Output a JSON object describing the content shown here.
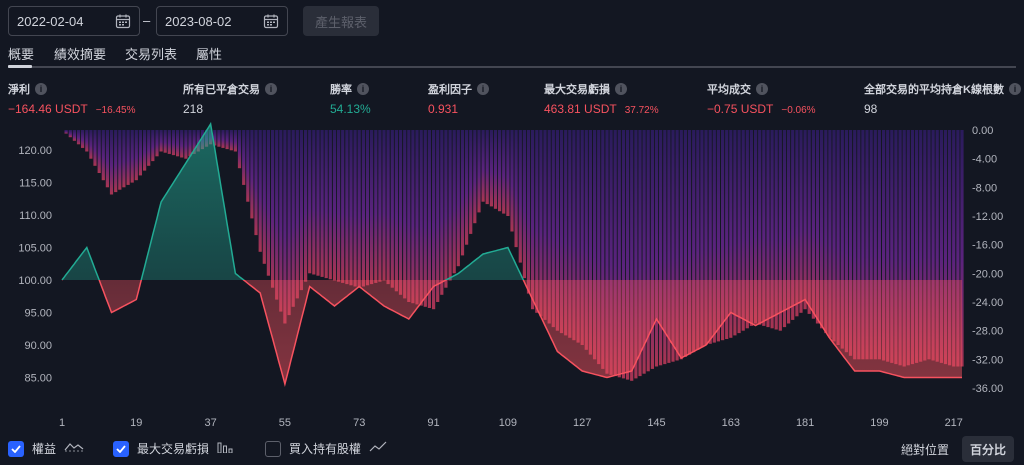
{
  "date_range": {
    "from": "2022-02-04",
    "separator": "–",
    "to": "2023-08-02",
    "generate_label": "產生報表"
  },
  "tabs": [
    "概要",
    "績效摘要",
    "交易列表",
    "屬性"
  ],
  "stats": [
    {
      "label": "淨利",
      "value": "−164.46 USDT",
      "pct": "−16.45%",
      "tone": "red"
    },
    {
      "label": "所有已平倉交易",
      "value": "218",
      "pct": "",
      "tone": "white"
    },
    {
      "label": "勝率",
      "value": "54.13%",
      "pct": "",
      "tone": "green"
    },
    {
      "label": "盈利因子",
      "value": "0.931",
      "pct": "",
      "tone": "red"
    },
    {
      "label": "最大交易虧損",
      "value": "463.81 USDT",
      "pct": "37.72%",
      "tone": "red"
    },
    {
      "label": "平均成交",
      "value": "−0.75 USDT",
      "pct": "−0.06%",
      "tone": "red"
    },
    {
      "label": "全部交易的平均持倉K線根數",
      "value": "98",
      "pct": "",
      "tone": "white"
    }
  ],
  "colors": {
    "profit": "#22ab94",
    "loss": "#f7525f",
    "drawdown": "#7b1fa2",
    "accent": "#2962ff"
  },
  "chart_data": {
    "type": "area",
    "x": [
      1,
      7,
      13,
      19,
      25,
      31,
      37,
      43,
      49,
      55,
      61,
      67,
      73,
      79,
      85,
      91,
      97,
      103,
      109,
      115,
      121,
      127,
      133,
      139,
      145,
      151,
      157,
      163,
      169,
      175,
      181,
      187,
      193,
      199,
      205,
      211,
      217,
      219
    ],
    "series": [
      {
        "name": "權益",
        "values": [
          100,
          105,
          95,
          97,
          112,
          118,
          124,
          101,
          98,
          84,
          99,
          96,
          99,
          96,
          94,
          99,
          101,
          104,
          105,
          97,
          89,
          86,
          85,
          86,
          94,
          88,
          90,
          95,
          93,
          95,
          97,
          91,
          86,
          86,
          85,
          85,
          85,
          85
        ]
      },
      {
        "name": "最大交易虧損",
        "values": [
          0,
          -3,
          -9,
          -7,
          -3,
          -4,
          -2,
          -3,
          -17,
          -27,
          -20,
          -21,
          -22,
          -21,
          -24,
          -25,
          -19,
          -10,
          -12,
          -25,
          -28,
          -30,
          -34,
          -35,
          -33,
          -32,
          -30,
          -29,
          -27,
          -28,
          -25,
          -29,
          -32,
          -32,
          -33,
          -32,
          -33,
          -33
        ]
      }
    ],
    "equity_baseline": 100,
    "left_axis": {
      "ylim": [
        80,
        125
      ],
      "ticks": [
        "120.00",
        "115.00",
        "110.00",
        "105.00",
        "100.00",
        "95.00",
        "90.00",
        "85.00"
      ]
    },
    "right_axis": {
      "ylim": [
        -38,
        0
      ],
      "ticks": [
        "0.00",
        "-4.00",
        "-8.00",
        "-12.00",
        "-16.00",
        "-20.00",
        "-24.00",
        "-28.00",
        "-32.00",
        "-36.00"
      ]
    },
    "x_ticks": [
      "1",
      "19",
      "37",
      "55",
      "73",
      "91",
      "109",
      "127",
      "145",
      "163",
      "181",
      "199",
      "217"
    ],
    "grid": false
  },
  "legend": {
    "equity_label": "權益",
    "drawdown_label": "最大交易虧損",
    "buyhold_label": "買入持有股權",
    "abs_label": "絕對位置",
    "pct_label": "百分比"
  }
}
